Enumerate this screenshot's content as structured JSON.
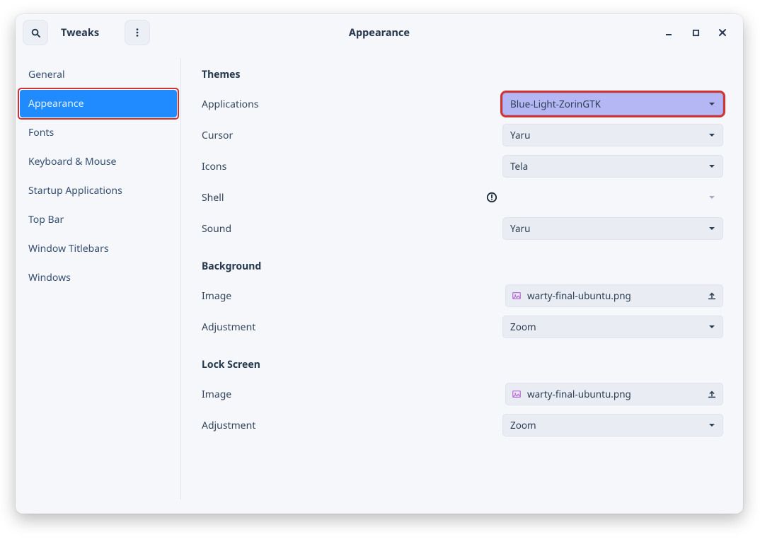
{
  "header": {
    "app_title": "Tweaks",
    "panel_title": "Appearance"
  },
  "sidebar": {
    "items": [
      {
        "label": "General"
      },
      {
        "label": "Appearance"
      },
      {
        "label": "Fonts"
      },
      {
        "label": "Keyboard & Mouse"
      },
      {
        "label": "Startup Applications"
      },
      {
        "label": "Top Bar"
      },
      {
        "label": "Window Titlebars"
      },
      {
        "label": "Windows"
      }
    ],
    "active_index": 1
  },
  "themes": {
    "title": "Themes",
    "rows": [
      {
        "label": "Applications",
        "value": "Blue-Light-ZorinGTK"
      },
      {
        "label": "Cursor",
        "value": "Yaru"
      },
      {
        "label": "Icons",
        "value": "Tela"
      },
      {
        "label": "Shell",
        "value": ""
      },
      {
        "label": "Sound",
        "value": "Yaru"
      }
    ]
  },
  "background": {
    "title": "Background",
    "image_label": "Image",
    "image_value": "warty-final-ubuntu.png",
    "adjustment_label": "Adjustment",
    "adjustment_value": "Zoom"
  },
  "lockscreen": {
    "title": "Lock Screen",
    "image_label": "Image",
    "image_value": "warty-final-ubuntu.png",
    "adjustment_label": "Adjustment",
    "adjustment_value": "Zoom"
  }
}
